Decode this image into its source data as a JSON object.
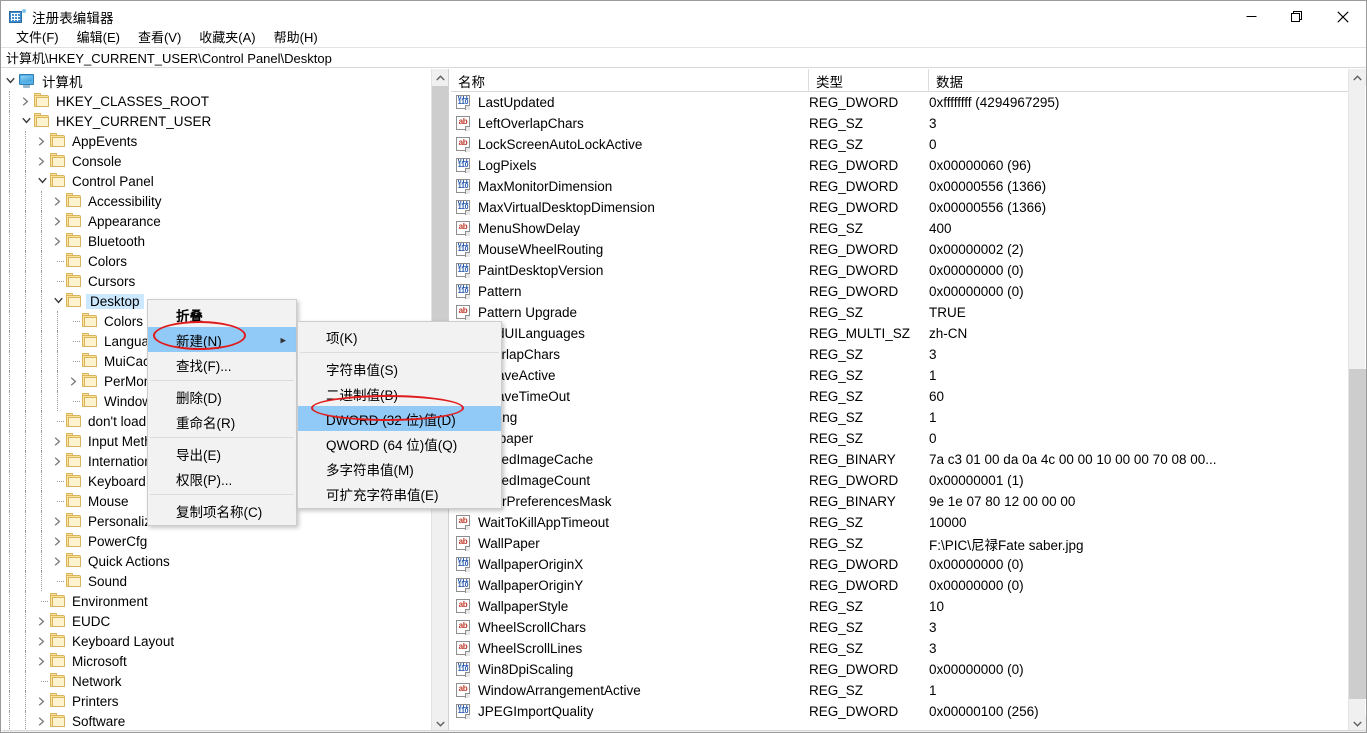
{
  "window": {
    "title": "注册表编辑器",
    "icon": "registry-editor-icon",
    "minimize_label": "最小化",
    "maximize_label": "最大化",
    "close_label": "关闭"
  },
  "menubar": {
    "items": [
      {
        "label": "文件(F)",
        "name": "menu-file"
      },
      {
        "label": "编辑(E)",
        "name": "menu-edit"
      },
      {
        "label": "查看(V)",
        "name": "menu-view"
      },
      {
        "label": "收藏夹(A)",
        "name": "menu-favorites"
      },
      {
        "label": "帮助(H)",
        "name": "menu-help"
      }
    ]
  },
  "address": {
    "path": "计算机\\HKEY_CURRENT_USER\\Control Panel\\Desktop"
  },
  "tree": {
    "nodes": [
      {
        "label": "计算机",
        "depth": 0,
        "icon": "computer-icon",
        "state": "expanded"
      },
      {
        "label": "HKEY_CLASSES_ROOT",
        "depth": 1,
        "icon": "folder-icon",
        "state": "collapsed"
      },
      {
        "label": "HKEY_CURRENT_USER",
        "depth": 1,
        "icon": "folder-icon",
        "state": "expanded"
      },
      {
        "label": "AppEvents",
        "depth": 2,
        "icon": "folder-icon",
        "state": "collapsed"
      },
      {
        "label": "Console",
        "depth": 2,
        "icon": "folder-icon",
        "state": "collapsed"
      },
      {
        "label": "Control Panel",
        "depth": 2,
        "icon": "folder-icon",
        "state": "expanded"
      },
      {
        "label": "Accessibility",
        "depth": 3,
        "icon": "folder-icon",
        "state": "collapsed"
      },
      {
        "label": "Appearance",
        "depth": 3,
        "icon": "folder-icon",
        "state": "collapsed"
      },
      {
        "label": "Bluetooth",
        "depth": 3,
        "icon": "folder-icon",
        "state": "collapsed"
      },
      {
        "label": "Colors",
        "depth": 3,
        "icon": "folder-icon",
        "state": "leaf"
      },
      {
        "label": "Cursors",
        "depth": 3,
        "icon": "folder-icon",
        "state": "leaf"
      },
      {
        "label": "Desktop",
        "depth": 3,
        "icon": "folder-icon",
        "state": "expanded",
        "selected": true
      },
      {
        "label": "Colors",
        "depth": 4,
        "icon": "folder-icon",
        "state": "leaf"
      },
      {
        "label": "LanguageConfiguration",
        "depth": 4,
        "icon": "folder-icon",
        "state": "leaf"
      },
      {
        "label": "MuiCached",
        "depth": 4,
        "icon": "folder-icon",
        "state": "leaf"
      },
      {
        "label": "PerMonitorSettings",
        "depth": 4,
        "icon": "folder-icon",
        "state": "collapsed"
      },
      {
        "label": "WindowMetrics",
        "depth": 4,
        "icon": "folder-icon",
        "state": "leaf"
      },
      {
        "label": "don't load",
        "depth": 3,
        "icon": "folder-icon",
        "state": "leaf"
      },
      {
        "label": "Input Method",
        "depth": 3,
        "icon": "folder-icon",
        "state": "collapsed"
      },
      {
        "label": "International",
        "depth": 3,
        "icon": "folder-icon",
        "state": "collapsed"
      },
      {
        "label": "Keyboard",
        "depth": 3,
        "icon": "folder-icon",
        "state": "leaf"
      },
      {
        "label": "Mouse",
        "depth": 3,
        "icon": "folder-icon",
        "state": "leaf"
      },
      {
        "label": "Personalization",
        "depth": 3,
        "icon": "folder-icon",
        "state": "collapsed"
      },
      {
        "label": "PowerCfg",
        "depth": 3,
        "icon": "folder-icon",
        "state": "collapsed"
      },
      {
        "label": "Quick Actions",
        "depth": 3,
        "icon": "folder-icon",
        "state": "collapsed"
      },
      {
        "label": "Sound",
        "depth": 3,
        "icon": "folder-icon",
        "state": "leaf"
      },
      {
        "label": "Environment",
        "depth": 2,
        "icon": "folder-icon",
        "state": "leaf"
      },
      {
        "label": "EUDC",
        "depth": 2,
        "icon": "folder-icon",
        "state": "collapsed"
      },
      {
        "label": "Keyboard Layout",
        "depth": 2,
        "icon": "folder-icon",
        "state": "collapsed"
      },
      {
        "label": "Microsoft",
        "depth": 2,
        "icon": "folder-icon",
        "state": "collapsed"
      },
      {
        "label": "Network",
        "depth": 2,
        "icon": "folder-icon",
        "state": "leaf"
      },
      {
        "label": "Printers",
        "depth": 2,
        "icon": "folder-icon",
        "state": "collapsed"
      },
      {
        "label": "Software",
        "depth": 2,
        "icon": "folder-icon",
        "state": "collapsed"
      }
    ]
  },
  "listview": {
    "columns": [
      {
        "label": "名称",
        "name": "column-name"
      },
      {
        "label": "类型",
        "name": "column-type"
      },
      {
        "label": "数据",
        "name": "column-data"
      }
    ],
    "rows": [
      {
        "name": "LastUpdated",
        "icon": "reg-dword-icon",
        "type": "REG_DWORD",
        "data": "0xffffffff (4294967295)"
      },
      {
        "name": "LeftOverlapChars",
        "icon": "reg-sz-icon",
        "type": "REG_SZ",
        "data": "3"
      },
      {
        "name": "LockScreenAutoLockActive",
        "icon": "reg-sz-icon",
        "type": "REG_SZ",
        "data": "0"
      },
      {
        "name": "LogPixels",
        "icon": "reg-dword-icon",
        "type": "REG_DWORD",
        "data": "0x00000060 (96)"
      },
      {
        "name": "MaxMonitorDimension",
        "icon": "reg-dword-icon",
        "type": "REG_DWORD",
        "data": "0x00000556 (1366)"
      },
      {
        "name": "MaxVirtualDesktopDimension",
        "icon": "reg-dword-icon",
        "type": "REG_DWORD",
        "data": "0x00000556 (1366)"
      },
      {
        "name": "MenuShowDelay",
        "icon": "reg-sz-icon",
        "type": "REG_SZ",
        "data": "400"
      },
      {
        "name": "MouseWheelRouting",
        "icon": "reg-dword-icon",
        "type": "REG_DWORD",
        "data": "0x00000002 (2)"
      },
      {
        "name": "PaintDesktopVersion",
        "icon": "reg-dword-icon",
        "type": "REG_DWORD",
        "data": "0x00000000 (0)"
      },
      {
        "name": "Pattern",
        "icon": "reg-dword-icon",
        "type": "REG_DWORD",
        "data": "0x00000000 (0)"
      },
      {
        "name": "Pattern Upgrade",
        "icon": "reg-sz-icon",
        "type": "REG_SZ",
        "data": "TRUE"
      },
      {
        "name": "PreferredUILanguages",
        "icon": "reg-sz-icon",
        "type": "REG_MULTI_SZ",
        "data": "zh-CN",
        "name_clipped": "erredUILanguages"
      },
      {
        "name": "RightOverlapChars",
        "icon": "reg-sz-icon",
        "type": "REG_SZ",
        "data": "3",
        "name_clipped": "tOverlapChars"
      },
      {
        "name": "ScreenSaveActive",
        "icon": "reg-sz-icon",
        "type": "REG_SZ",
        "data": "1",
        "name_clipped": "enSaveActive"
      },
      {
        "name": "ScreenSaveTimeOut",
        "icon": "reg-sz-icon",
        "type": "REG_SZ",
        "data": "60",
        "name_clipped": "enSaveTimeOut"
      },
      {
        "name": "SnapSizing",
        "icon": "reg-sz-icon",
        "type": "REG_SZ",
        "data": "1",
        "name_clipped": "pSizing"
      },
      {
        "name": "TileWallpaper",
        "icon": "reg-sz-icon",
        "type": "REG_SZ",
        "data": "0",
        "name_clipped": "Wallpaper"
      },
      {
        "name": "TranscodedImageCache",
        "icon": "reg-binary-icon",
        "type": "REG_BINARY",
        "data": "7a c3 01 00 da 0a 4c 00 00 10 00 00 70 08 00...",
        "name_clipped": "scodedImageCache"
      },
      {
        "name": "TranscodedImageCount",
        "icon": "reg-dword-icon",
        "type": "REG_DWORD",
        "data": "0x00000001 (1)",
        "name_clipped": "scodedImageCount"
      },
      {
        "name": "UserPreferencesMask",
        "icon": "reg-dword-icon",
        "type": "REG_BINARY",
        "data": "9e 1e 07 80 12 00 00 00"
      },
      {
        "name": "WaitToKillAppTimeout",
        "icon": "reg-sz-icon",
        "type": "REG_SZ",
        "data": "10000"
      },
      {
        "name": "WallPaper",
        "icon": "reg-sz-icon",
        "type": "REG_SZ",
        "data": "F:\\PIC\\尼禄Fate saber.jpg"
      },
      {
        "name": "WallpaperOriginX",
        "icon": "reg-dword-icon",
        "type": "REG_DWORD",
        "data": "0x00000000 (0)"
      },
      {
        "name": "WallpaperOriginY",
        "icon": "reg-dword-icon",
        "type": "REG_DWORD",
        "data": "0x00000000 (0)"
      },
      {
        "name": "WallpaperStyle",
        "icon": "reg-sz-icon",
        "type": "REG_SZ",
        "data": "10"
      },
      {
        "name": "WheelScrollChars",
        "icon": "reg-sz-icon",
        "type": "REG_SZ",
        "data": "3"
      },
      {
        "name": "WheelScrollLines",
        "icon": "reg-sz-icon",
        "type": "REG_SZ",
        "data": "3"
      },
      {
        "name": "Win8DpiScaling",
        "icon": "reg-dword-icon",
        "type": "REG_DWORD",
        "data": "0x00000000 (0)"
      },
      {
        "name": "WindowArrangementActive",
        "icon": "reg-sz-icon",
        "type": "REG_SZ",
        "data": "1"
      },
      {
        "name": "JPEGImportQuality",
        "icon": "reg-dword-icon",
        "type": "REG_DWORD",
        "data": "0x00000100 (256)"
      }
    ]
  },
  "context_menu": {
    "items": [
      {
        "label": "折叠",
        "name": "ctx-collapse",
        "bold": true
      },
      {
        "label": "新建(N)",
        "name": "ctx-new",
        "highlighted": true,
        "submenu": true,
        "circled": true
      },
      {
        "label": "查找(F)...",
        "name": "ctx-find"
      },
      {
        "separator": true
      },
      {
        "label": "删除(D)",
        "name": "ctx-delete"
      },
      {
        "label": "重命名(R)",
        "name": "ctx-rename"
      },
      {
        "separator": true
      },
      {
        "label": "导出(E)",
        "name": "ctx-export"
      },
      {
        "label": "权限(P)...",
        "name": "ctx-permissions"
      },
      {
        "separator": true
      },
      {
        "label": "复制项名称(C)",
        "name": "ctx-copy-key-name"
      }
    ]
  },
  "submenu": {
    "items": [
      {
        "label": "项(K)",
        "name": "sub-new-key"
      },
      {
        "separator": true
      },
      {
        "label": "字符串值(S)",
        "name": "sub-new-string"
      },
      {
        "label": "二进制值(B)",
        "name": "sub-new-binary"
      },
      {
        "label": "DWORD (32 位)值(D)",
        "name": "sub-new-dword32",
        "highlighted": true,
        "circled": true
      },
      {
        "label": "QWORD (64 位)值(Q)",
        "name": "sub-new-qword64"
      },
      {
        "label": "多字符串值(M)",
        "name": "sub-new-multi-string"
      },
      {
        "label": "可扩充字符串值(E)",
        "name": "sub-new-expandable-string"
      }
    ]
  },
  "colors": {
    "selection": "#cce8ff",
    "menu_highlight": "#91c9f7",
    "annotation_red": "#e01b1b",
    "folder_yellow": "#fde29a",
    "scrollbar_thumb": "#cdcdcd"
  }
}
